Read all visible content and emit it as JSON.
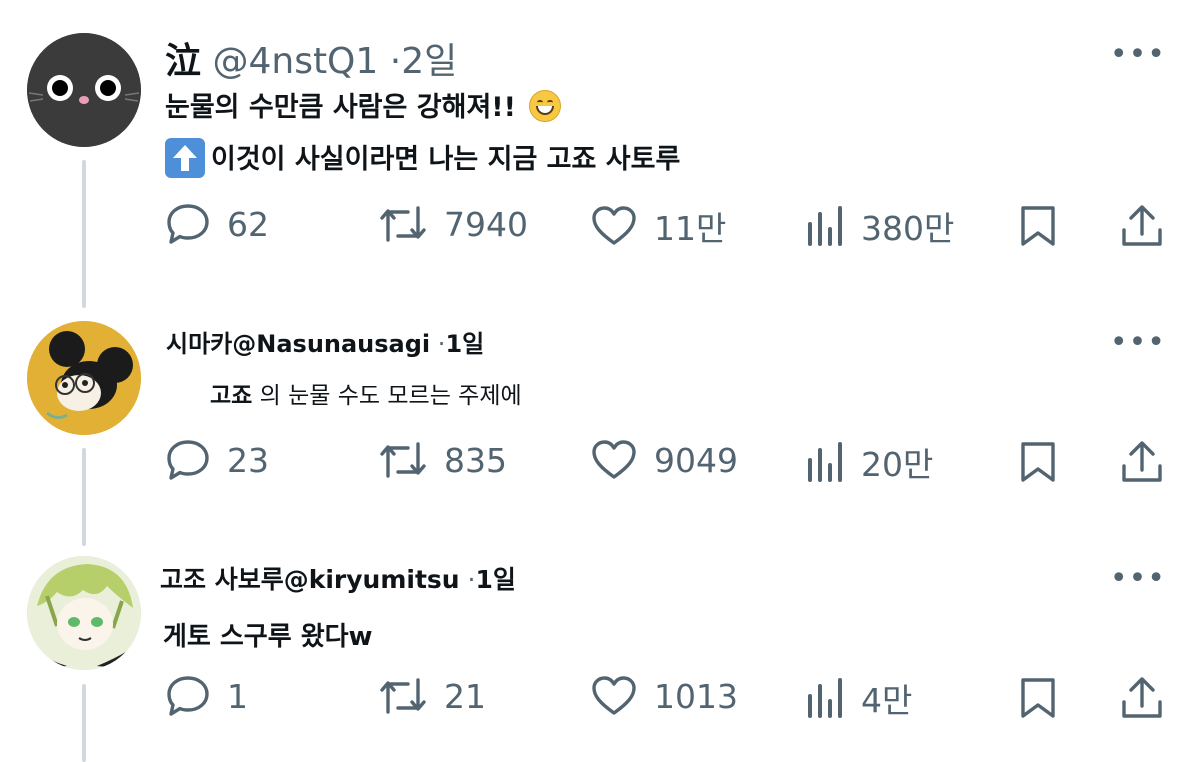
{
  "posts": [
    {
      "name": "泣",
      "handle": "@4nstQ1",
      "sep": "·",
      "time": "2일",
      "lines": [
        "눈물의 수만큼 사람은 강해져!!",
        "이것이 사실이라면 나는 지금 고죠 사토루"
      ],
      "emoji_after_line1": "grinning-face-emoji",
      "emoji_before_line2": "up-arrow-emoji",
      "replies": "62",
      "reposts": "7940",
      "likes": "11만",
      "views": "380만"
    },
    {
      "name": "시마카",
      "handle": "@Nasunausagi",
      "sep": "·",
      "time": "1일",
      "text_bold": "고죠",
      "text_rest": " 의 눈물 수도 모르는 주제에",
      "replies": "23",
      "reposts": "835",
      "likes": "9049",
      "views": "20만"
    },
    {
      "name": "고조 사보루",
      "handle": "@kiryumitsu",
      "sep": "·",
      "time": "1일",
      "text": "게토 스구루 왔다w",
      "replies": "1",
      "reposts": "21",
      "likes": "1013",
      "views": "4만"
    }
  ],
  "more_label": "•••",
  "colors": {
    "text": "#0f1419",
    "muted": "#536471",
    "thread_line": "#cfd9de"
  }
}
